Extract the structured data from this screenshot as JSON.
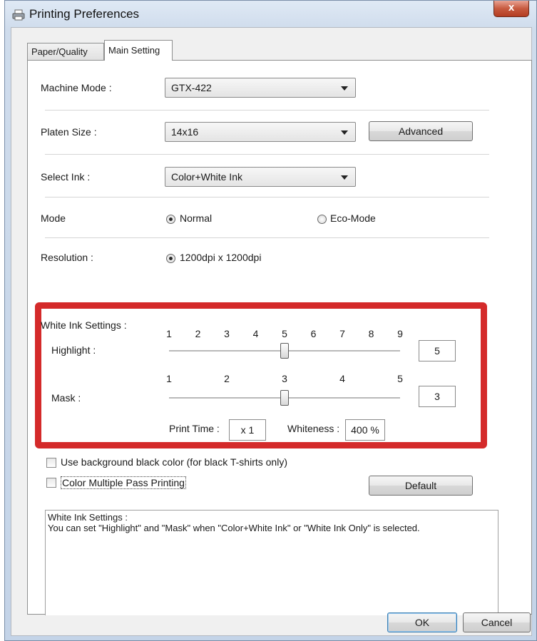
{
  "window": {
    "title": "Printing Preferences",
    "close_label": "x"
  },
  "tabs": [
    {
      "label": "Paper/Quality"
    },
    {
      "label": "Main Setting"
    }
  ],
  "machine_mode": {
    "label": "Machine Mode :",
    "value": "GTX-422"
  },
  "platen_size": {
    "label": "Platen Size :",
    "value": "14x16",
    "advanced_label": "Advanced"
  },
  "select_ink": {
    "label": "Select Ink :",
    "value": "Color+White Ink"
  },
  "mode": {
    "label": "Mode",
    "options": [
      {
        "label": "Normal",
        "selected": true
      },
      {
        "label": "Eco-Mode",
        "selected": false
      }
    ]
  },
  "resolution": {
    "label": "Resolution :",
    "option": "1200dpi x 1200dpi"
  },
  "white_ink": {
    "title": "White Ink Settings :",
    "highlight": {
      "label": "Highlight :",
      "ticks": [
        "1",
        "2",
        "3",
        "4",
        "5",
        "6",
        "7",
        "8",
        "9"
      ],
      "value": "5"
    },
    "mask": {
      "label": "Mask :",
      "ticks": [
        "1",
        "2",
        "3",
        "4",
        "5"
      ],
      "value": "3"
    },
    "print_time_label": "Print Time :",
    "print_time_value": "x 1",
    "whiteness_label": "Whiteness :",
    "whiteness_value": "400 %"
  },
  "options": {
    "background_black": "Use background black color (for black T-shirts only)",
    "multi_pass": "Color Multiple Pass Printing",
    "default_label": "Default"
  },
  "description": {
    "line1": "White Ink Settings :",
    "line2": "You can set \"Highlight\" and \"Mask\" when \"Color+White Ink\" or \"White Ink Only\" is selected."
  },
  "footer": {
    "ok_label": "OK",
    "cancel_label": "Cancel"
  },
  "colors": {
    "highlight_border": "#d42a2a"
  }
}
